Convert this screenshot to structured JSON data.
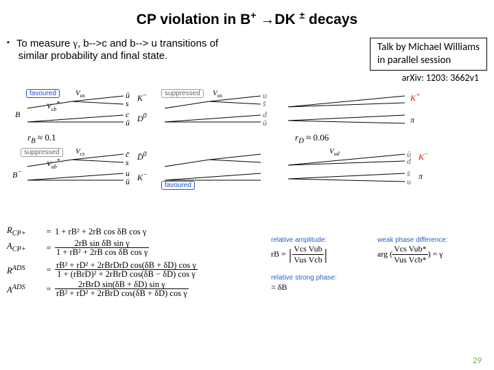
{
  "title": {
    "prefix": "CP  violation in B",
    "sup1": "+",
    "arrow": "→",
    "mid": "DK",
    "sup2": "±",
    "suffix": "   decays"
  },
  "bullet": {
    "marker": "▪",
    "line1a": "To  measure ",
    "gamma": "γ",
    "line1b": ",   b-->c and b-->  u   transitions of",
    "line2": "similar  probability and final state."
  },
  "note": {
    "l1": "Talk by Michael Williams",
    "l2": "in parallel session"
  },
  "arxiv": "arXiv: 1203: 3662v1",
  "tags": {
    "favoured": "favoured",
    "suppressed": "suppressed"
  },
  "ckm": {
    "vus": "V",
    "vus_sub": "us",
    "vcb": "V",
    "vcb_sub": "cb",
    "vcb_star": "*",
    "vcs": "V",
    "vcs_sub": "cs",
    "vcs_star": "*",
    "vub": "V",
    "vub_sub": "ub",
    "vub_star": "*",
    "vud": "V",
    "vud_sub": "ud"
  },
  "particles": {
    "B": "B",
    "Bm": "B",
    "Bm_sup": "−",
    "D0": "D",
    "D0_sup": "0",
    "D0b": "D̄",
    "D0b_sup": "0",
    "Km": "K",
    "Km_sup": "−",
    "Kp": "K",
    "Kp_sup": "+",
    "pi": "π",
    "u": "u",
    "ub": "ū",
    "s": "s",
    "sb": "s̄",
    "c": "c",
    "cb": "c̄",
    "d": "d",
    "db": "d̄",
    "b": "b"
  },
  "rtext": {
    "rB": "r",
    "rB_sub": "B",
    "rB_val": " ≈ 0.1",
    "rD": "r",
    "rD_sub": "D",
    "rD_val": " ≈ 0.06"
  },
  "formulas": {
    "RCPp_lhs": "R",
    "RCPp_sup": "CP+",
    "RCPp_rhs": "1 + rB² + 2rB cos δB cos γ",
    "ACPp_lhs": "A",
    "ACPp_sup": "CP+",
    "ACPp_num": "2rB sin δB sin γ",
    "ACPp_den": "1 + rB² + 2rB cos δB cos γ",
    "RADS_lhs": "R",
    "RADS_sup": "ADS",
    "RADS_num": "rB² + rD² + 2rBrDrD cos(δB + δD) cos γ",
    "RADS_den": "1 + (rBrD)² + 2rBrD cos(δB − δD) cos γ",
    "AADS_lhs": "A",
    "AADS_sup": "ADS",
    "AADS_num": "2rBrD sin(δB + δD) sin γ",
    "AADS_den": "rB² + rD² + 2rBrD cos(δB + δD) cos γ"
  },
  "right": {
    "relamp": "relative amplitude:",
    "weakphase": "weak phase difference:",
    "relstrong": "relative strong phase:",
    "rB": "rB =",
    "ratio_top_a": "Vcs  Vub",
    "ratio_bot_a": "Vus  Vcb",
    "arg": "arg",
    "argfrac_top": "Vcs  Vub*",
    "argfrac_bot": "Vus  Vcb*",
    "eqgamma": "= γ",
    "eqdelta": "= δB"
  },
  "pagenum": "29"
}
